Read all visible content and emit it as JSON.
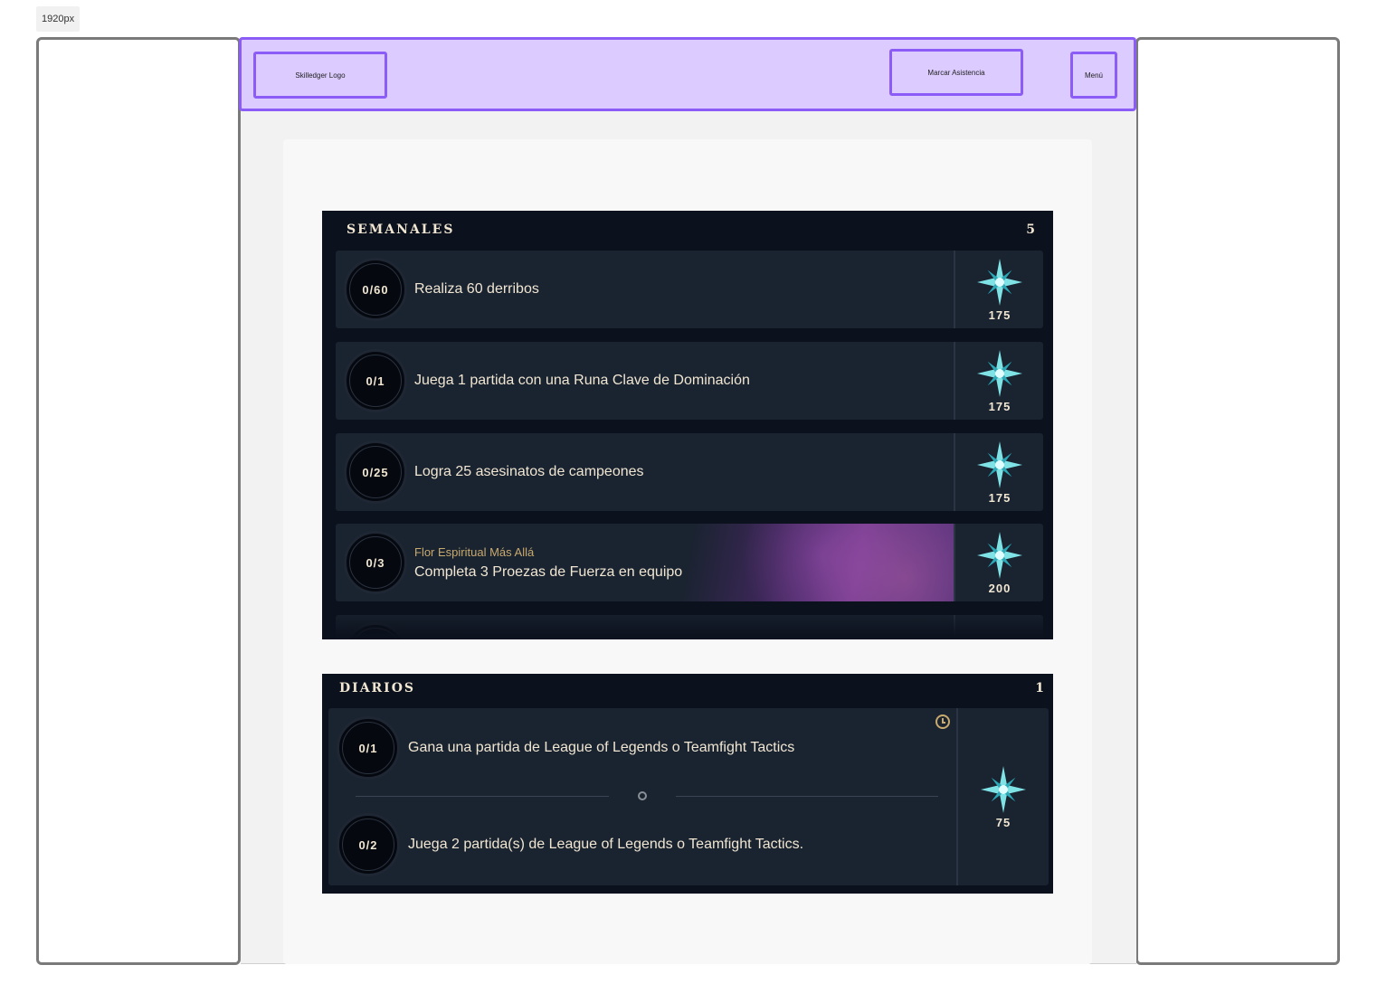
{
  "size_label": "1920px",
  "topbar": {
    "logo_label": "Skilledger Logo",
    "attendance_label": "Marcar Asistencia",
    "menu_label": "Menú"
  },
  "weekly": {
    "title": "SEMANALES",
    "count": "5",
    "missions": [
      {
        "progress": "0/60",
        "subtitle": "",
        "text": "Realiza 60 derribos",
        "reward": "175"
      },
      {
        "progress": "0/1",
        "subtitle": "",
        "text": "Juega 1 partida con una Runa Clave de Dominación",
        "reward": "175"
      },
      {
        "progress": "0/25",
        "subtitle": "",
        "text": "Logra 25 asesinatos de campeones",
        "reward": "175"
      },
      {
        "progress": "0/3",
        "subtitle": "Flor Espiritual Más Allá",
        "text": "Completa 3 Proezas de Fuerza en equipo",
        "reward": "200"
      }
    ]
  },
  "daily": {
    "title": "DIARIOS",
    "count": "1",
    "missions": [
      {
        "progress": "0/1",
        "text": "Gana una partida de League of Legends o Teamfight Tactics"
      },
      {
        "progress": "0/2",
        "text": "Juega 2 partida(s) de League of Legends o Teamfight Tactics."
      }
    ],
    "reward": "75"
  },
  "colors": {
    "accent_purple": "#8b5cf6",
    "topbar_fill": "#dccbff",
    "panel_bg": "#0b111d",
    "row_bg": "#1a2330",
    "gold_text": "#f0e6d2",
    "gold_accent": "#c8aa6e"
  }
}
